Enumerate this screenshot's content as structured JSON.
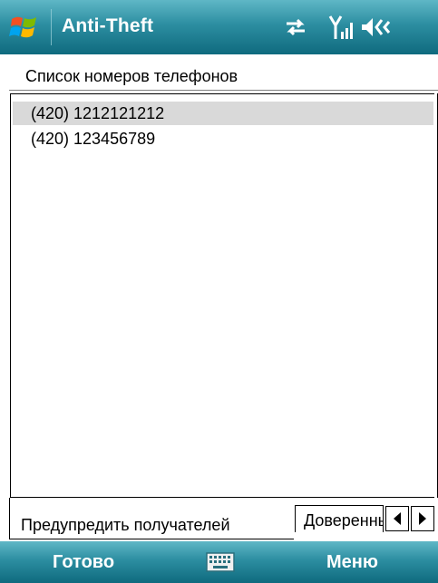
{
  "titlebar": {
    "app_title": "Anti-Theft",
    "icons": [
      "windows-start-icon",
      "connectivity-icon",
      "signal-icon",
      "speaker-icon"
    ]
  },
  "header": {
    "label": "Список номеров телефонов"
  },
  "phone_list": {
    "items": [
      {
        "number": "(420) 1212121212",
        "selected": true
      },
      {
        "number": "(420) 123456789",
        "selected": false
      }
    ]
  },
  "tabs": {
    "items": [
      {
        "label": "Предупредить получателей",
        "active": true
      },
      {
        "label": "Доверенные",
        "active": false
      }
    ]
  },
  "softkeys": {
    "left": "Готово",
    "right": "Меню",
    "center_icon": "keyboard-icon"
  },
  "colors": {
    "bar_top": "#5fb7c6",
    "bar_bottom": "#0f6a7e",
    "selection": "#d9d9d9"
  }
}
